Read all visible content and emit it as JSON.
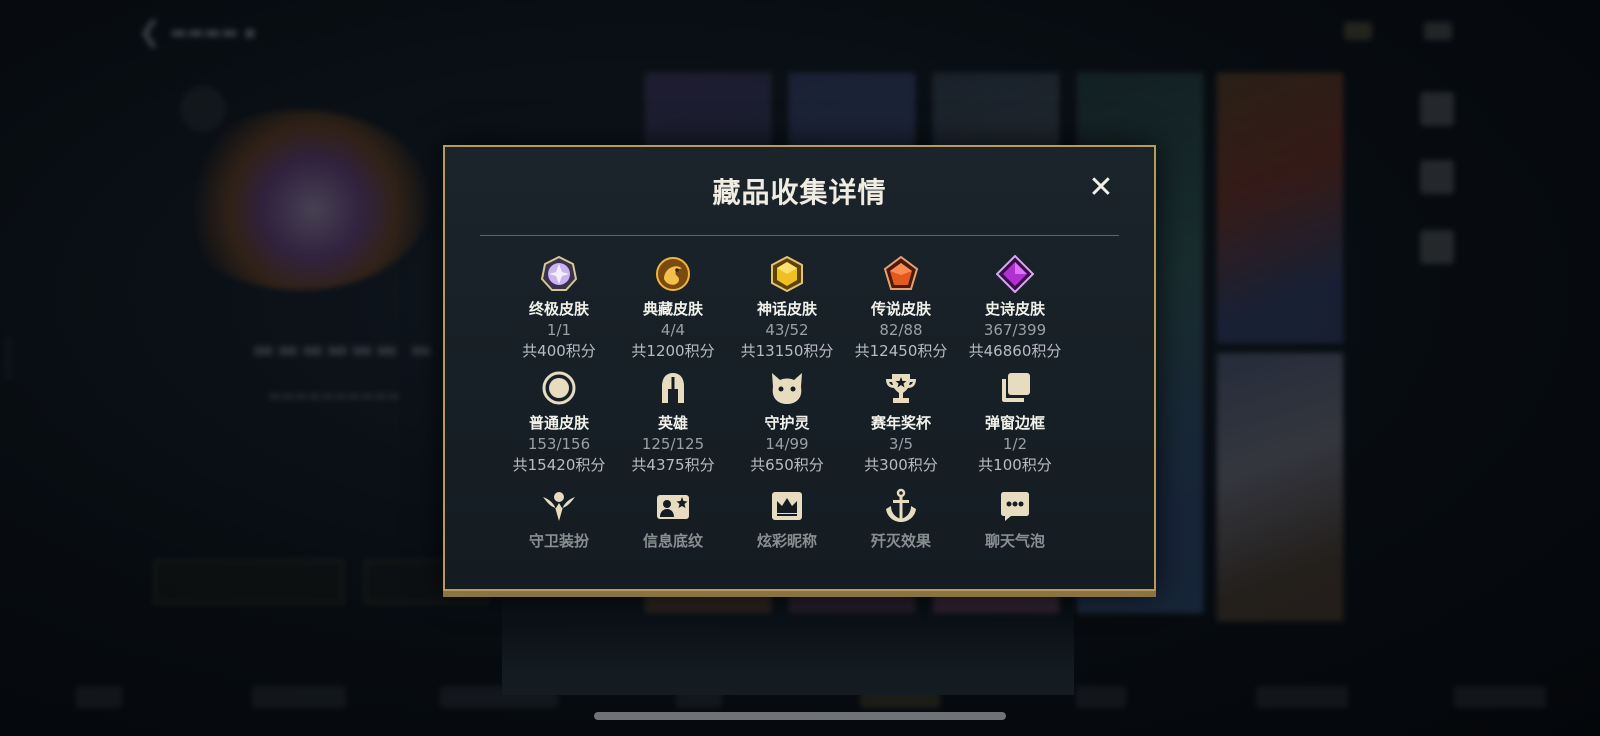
{
  "modal": {
    "title": "藏品收集详情",
    "close_label": "✕"
  },
  "items": [
    {
      "name": "终极皮肤",
      "count": "1/1",
      "points": "共400积分",
      "icon": "ultimate-skin-gem-icon"
    },
    {
      "name": "典藏皮肤",
      "count": "4/4",
      "points": "共1200积分",
      "icon": "prestige-skin-dragon-icon"
    },
    {
      "name": "神话皮肤",
      "count": "43/52",
      "points": "共13150积分",
      "icon": "mythic-skin-gem-icon"
    },
    {
      "name": "传说皮肤",
      "count": "82/88",
      "points": "共12450积分",
      "icon": "legendary-skin-gem-icon"
    },
    {
      "name": "史诗皮肤",
      "count": "367/399",
      "points": "共46860积分",
      "icon": "epic-skin-gem-icon"
    },
    {
      "name": "普通皮肤",
      "count": "153/156",
      "points": "共15420积分",
      "icon": "normal-skin-circle-icon"
    },
    {
      "name": "英雄",
      "count": "125/125",
      "points": "共4375积分",
      "icon": "helmet-icon"
    },
    {
      "name": "守护灵",
      "count": "14/99",
      "points": "共650积分",
      "icon": "guardian-creature-icon"
    },
    {
      "name": "赛年奖杯",
      "count": "3/5",
      "points": "共300积分",
      "icon": "trophy-icon"
    },
    {
      "name": "弹窗边框",
      "count": "1/2",
      "points": "共100积分",
      "icon": "frame-stack-icon"
    },
    {
      "name": "守卫装扮",
      "icon": "ward-skin-icon"
    },
    {
      "name": "信息底纹",
      "icon": "info-card-icon"
    },
    {
      "name": "炫彩昵称",
      "icon": "nickname-crown-icon"
    },
    {
      "name": "歼灭效果",
      "icon": "anchor-icon"
    },
    {
      "name": "聊天气泡",
      "icon": "chat-bubble-icon"
    }
  ],
  "colors": {
    "modal_border": "#b89a5a",
    "title_text": "#f0ece2",
    "ultimate": "#c9b3f0",
    "prestige": "#e0a12a",
    "mythic": "#f0c020",
    "legendary": "#e25a20",
    "epic": "#b030d0"
  }
}
